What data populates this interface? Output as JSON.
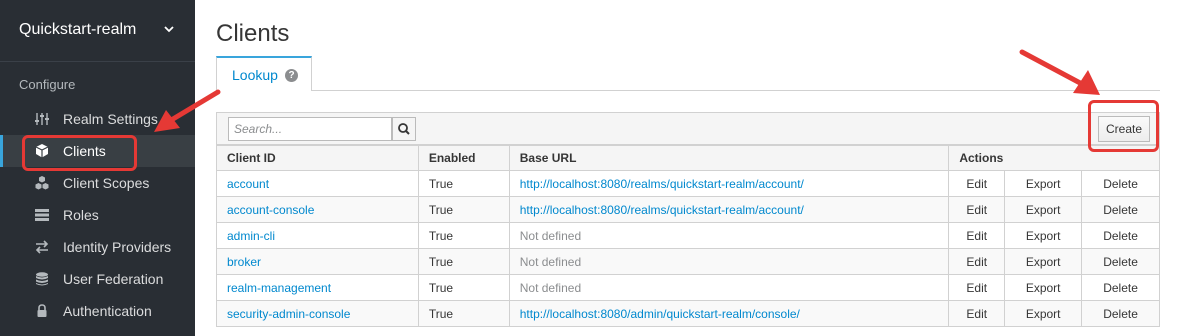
{
  "sidebar": {
    "realm": "Quickstart-realm",
    "section": "Configure",
    "items": [
      {
        "label": "Realm Settings",
        "icon": "sliders-icon"
      },
      {
        "label": "Clients",
        "icon": "cube-icon",
        "active": true
      },
      {
        "label": "Client Scopes",
        "icon": "cubes-icon"
      },
      {
        "label": "Roles",
        "icon": "list-icon"
      },
      {
        "label": "Identity Providers",
        "icon": "exchange-icon"
      },
      {
        "label": "User Federation",
        "icon": "database-icon"
      },
      {
        "label": "Authentication",
        "icon": "lock-icon"
      }
    ]
  },
  "main": {
    "title": "Clients",
    "tab": {
      "label": "Lookup",
      "help": "?"
    },
    "search": {
      "placeholder": "Search..."
    },
    "create_label": "Create",
    "table": {
      "headers": [
        "Client ID",
        "Enabled",
        "Base URL",
        "Actions"
      ],
      "action_labels": [
        "Edit",
        "Export",
        "Delete"
      ],
      "rows": [
        {
          "client_id": "account",
          "enabled": "True",
          "base_url": "http://localhost:8080/realms/quickstart-realm/account/"
        },
        {
          "client_id": "account-console",
          "enabled": "True",
          "base_url": "http://localhost:8080/realms/quickstart-realm/account/"
        },
        {
          "client_id": "admin-cli",
          "enabled": "True",
          "base_url": "Not defined"
        },
        {
          "client_id": "broker",
          "enabled": "True",
          "base_url": "Not defined"
        },
        {
          "client_id": "realm-management",
          "enabled": "True",
          "base_url": "Not defined"
        },
        {
          "client_id": "security-admin-console",
          "enabled": "True",
          "base_url": "http://localhost:8080/admin/quickstart-realm/console/"
        }
      ]
    }
  },
  "colors": {
    "sidebar_bg": "#292e34",
    "link": "#0088ce",
    "highlight": "#e53935"
  }
}
